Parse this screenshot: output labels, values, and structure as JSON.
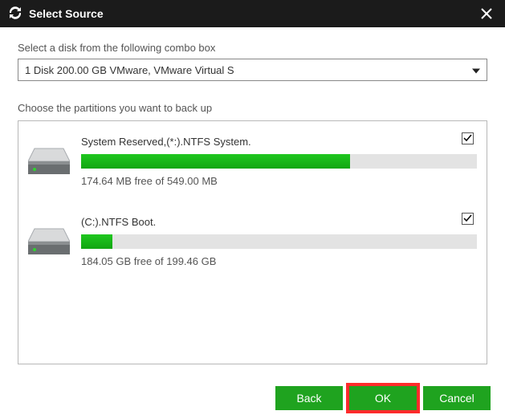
{
  "titlebar": {
    "title": "Select Source"
  },
  "prompt_disk": "Select a disk from the following combo box",
  "combo": {
    "selected": "1 Disk 200.00 GB VMware,  VMware Virtual S"
  },
  "prompt_partitions": "Choose the partitions you want to back up",
  "partitions": [
    {
      "name": "System Reserved,(*:).NTFS System.",
      "free_text": "174.64 MB free of 549.00 MB",
      "used_pct": 68,
      "checked": true
    },
    {
      "name": "(C:).NTFS Boot.",
      "free_text": "184.05 GB free of 199.46 GB",
      "used_pct": 8,
      "checked": true
    }
  ],
  "buttons": {
    "back": "Back",
    "ok": "OK",
    "cancel": "Cancel"
  },
  "icons": {
    "logo": "cycle-icon",
    "close": "close-icon",
    "caret": "chevron-down-icon",
    "disk": "disk-icon",
    "check": "checkmark-icon"
  },
  "colors": {
    "accent_green": "#1fa31f",
    "bar_fill": "#1fc71f",
    "highlight_red": "#ff2b2b",
    "titlebar_bg": "#1b1b1b"
  }
}
